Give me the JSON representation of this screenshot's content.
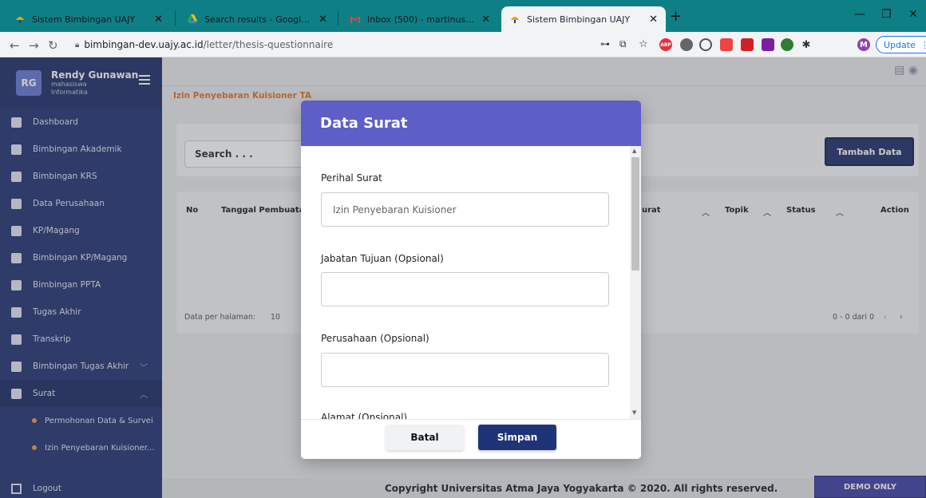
{
  "browser": {
    "tabs": [
      {
        "title": "Sistem Bimbingan UAJY",
        "active": false
      },
      {
        "title": "Search results - Google Drive",
        "active": false
      },
      {
        "title": "Inbox (500) - martinusmaslim122",
        "active": false
      },
      {
        "title": "Sistem Bimbingan UAJY",
        "active": true
      }
    ],
    "url_host": "bimbingan-dev.uajy.ac.id",
    "url_path": "/letter/thesis-questionnaire",
    "update_label": "Update",
    "profile_initial": "M",
    "abp_label": "ABP"
  },
  "sidebar": {
    "avatar": "RG",
    "user_name": "Rendy Gunawan",
    "user_role": "mahasiswa",
    "user_dept": "Informatika",
    "items": [
      {
        "label": "Dashboard"
      },
      {
        "label": "Bimbingan Akademik"
      },
      {
        "label": "Bimbingan KRS"
      },
      {
        "label": "Data Perusahaan"
      },
      {
        "label": "KP/Magang"
      },
      {
        "label": "Bimbingan KP/Magang"
      },
      {
        "label": "Bimbingan PPTA"
      },
      {
        "label": "Tugas Akhir"
      },
      {
        "label": "Transkrip"
      },
      {
        "label": "Bimbingan Tugas Akhir"
      },
      {
        "label": "Surat"
      }
    ],
    "sub_items": [
      {
        "label": "Permohonan Data & Survei"
      },
      {
        "label": "Izin Penyebaran Kuisioner..."
      }
    ],
    "logout": "Logout"
  },
  "main": {
    "breadcrumb": "Izin Penyebaran Kuisioner TA",
    "search_placeholder": "Search . . .",
    "add_button": "Tambah Data",
    "columns": [
      "No",
      "Tanggal Pembuata",
      "urat",
      "Topik",
      "Status",
      "Action"
    ],
    "per_page_label": "Data per halaman:",
    "per_page_value": "10",
    "page_info": "0 - 0 dari 0"
  },
  "modal": {
    "title": "Data Surat",
    "fields": [
      {
        "label": "Perihal Surat",
        "value": "Izin Penyebaran Kuisioner"
      },
      {
        "label": "Jabatan Tujuan (Opsional)",
        "value": ""
      },
      {
        "label": "Perusahaan (Opsional)",
        "value": ""
      },
      {
        "label": "Alamat (Opsional)",
        "value": ""
      }
    ],
    "cancel": "Batal",
    "save": "Simpan"
  },
  "footer": {
    "copyright": "Copyright Universitas Atma Jaya Yogyakarta © 2020. All rights reserved.",
    "demo": "DEMO ONLY"
  },
  "colors": {
    "sidebar": "#2a3a75",
    "modal_header": "#5d5ec8",
    "accent_orange": "#e0762f",
    "primary_button": "#1f3477"
  }
}
